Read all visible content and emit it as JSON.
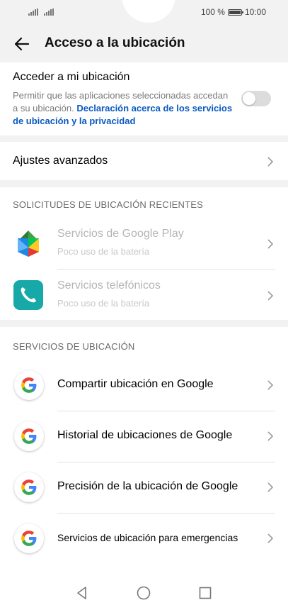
{
  "status_bar": {
    "battery_text": "100 %",
    "time": "10:00"
  },
  "header": {
    "back_icon": "arrow-back-icon",
    "title": "Acceso a la ubicación"
  },
  "location_access": {
    "title": "Acceder a mi ubicación",
    "description": "Permitir que las aplicaciones seleccionadas accedan a su ubicación.",
    "link_text": "Declaración acerca de los servicios de ubicación y la privacidad",
    "toggle_on": false
  },
  "advanced": {
    "label": "Ajustes avanzados"
  },
  "recent_requests": {
    "header": "SOLICITUDES DE UBICACIÓN RECIENTES",
    "items": [
      {
        "title": "Servicios de Google Play",
        "subtitle": "Poco uso de la batería",
        "icon": "google-play-services-icon"
      },
      {
        "title": "Servicios telefónicos",
        "subtitle": "Poco uso de la batería",
        "icon": "phone-icon"
      }
    ]
  },
  "location_services": {
    "header": "SERVICIOS DE UBICACIÓN",
    "items": [
      {
        "label": "Compartir ubicación en Google",
        "icon": "google-icon"
      },
      {
        "label": "Historial de ubicaciones de Google",
        "icon": "google-icon"
      },
      {
        "label": "Precisión de la ubicación de Google",
        "icon": "google-icon"
      },
      {
        "label": "Servicios de ubicación para emergencias",
        "icon": "google-icon"
      }
    ]
  },
  "nav_bar": {
    "back": "nav-back-icon",
    "home": "nav-home-icon",
    "recents": "nav-recents-icon"
  },
  "colors": {
    "link": "#0a59c1",
    "background": "#f2f2f2",
    "disabled_text": "#b5b5b5"
  }
}
